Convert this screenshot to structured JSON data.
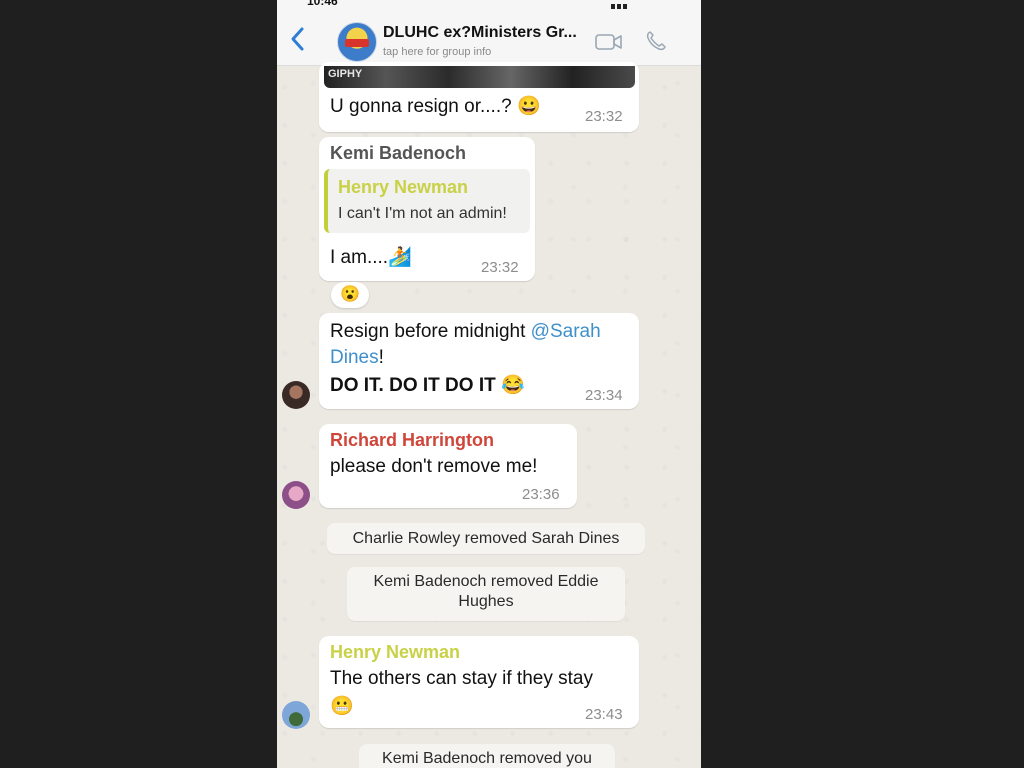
{
  "statusbar": {
    "time": "10:46"
  },
  "header": {
    "title": "DLUHC ex?Ministers Gr...",
    "subtitle": "tap here for group info",
    "back_icon": "chevron-left-icon",
    "video_icon": "video-camera-icon",
    "call_icon": "phone-icon"
  },
  "colors": {
    "chat_background": "#ece9e3",
    "bubble": "#ffffff",
    "mention": "#3f8fcb",
    "sender_kemi": "#555555",
    "sender_henry": "#c9d147",
    "sender_richard": "#d0453a",
    "back_arrow": "#2e7fd3"
  },
  "messages": {
    "m1": {
      "gif_label": "GIPHY",
      "text": "U gonna resign or....? 😀",
      "time": "23:32"
    },
    "m2": {
      "sender": "Kemi Badenoch",
      "quote_sender": "Henry  Newman",
      "quote_text": "I can't I'm not an admin!",
      "text": "I am....🏄",
      "time": "23:32",
      "reaction": "😮"
    },
    "m3": {
      "line1_prefix": "Resign before midnight ",
      "mention_part1": "@Sarah",
      "mention_part2": "Dines",
      "line2_suffix": "!",
      "line3": "DO IT. DO IT DO IT 😂",
      "time": "23:34"
    },
    "m4": {
      "sender": "Richard Harrington",
      "text": "please don't remove me!",
      "time": "23:36"
    },
    "sys1": "Charlie Rowley removed Sarah  Dines",
    "sys2_line1": "Kemi Badenoch removed Eddie",
    "sys2_line2": "Hughes",
    "m5": {
      "sender": "Henry  Newman",
      "line1": "The others can stay if they stay",
      "line2": "😬",
      "time": "23:43"
    },
    "sys3": "Kemi Badenoch removed you"
  }
}
